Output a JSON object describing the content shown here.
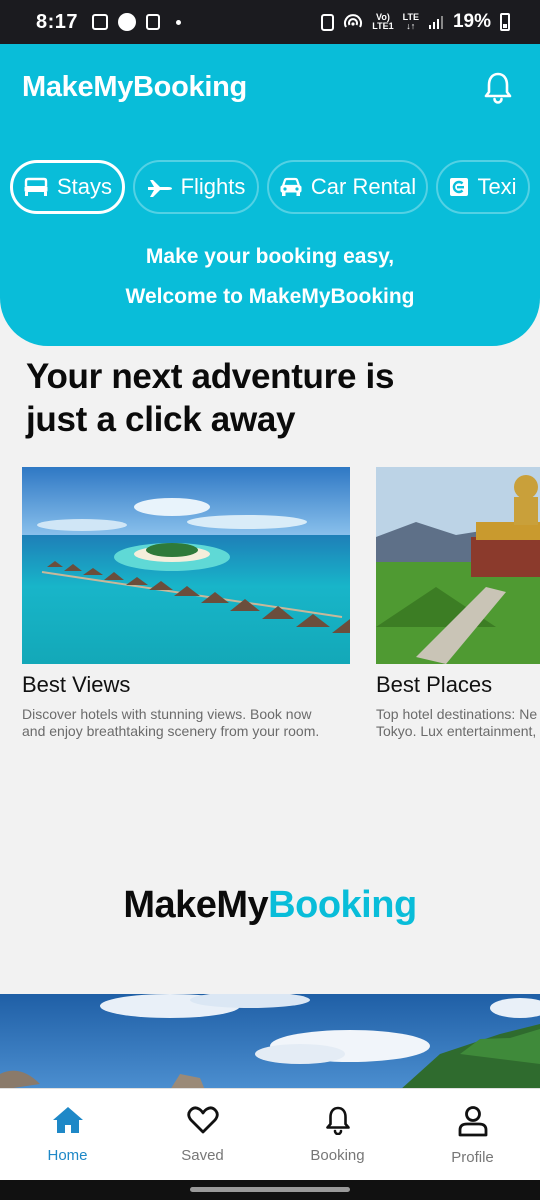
{
  "status_bar": {
    "time": "8:17",
    "network_line1": "Vo)",
    "network_line2": "LTE1",
    "lte_line1": "LTE",
    "lte_line2": "↓↑",
    "battery": "19%"
  },
  "header": {
    "title": "MakeMyBooking",
    "tabs": [
      {
        "label": "Stays",
        "icon": "bed-icon"
      },
      {
        "label": "Flights",
        "icon": "airplane-icon"
      },
      {
        "label": "Car Rental",
        "icon": "car-icon"
      },
      {
        "label": "Texi",
        "icon": "taxi-icon"
      }
    ],
    "welcome_line1": "Make your booking easy,",
    "welcome_line2": "Welcome to MakeMyBooking"
  },
  "main": {
    "headline": "Your next adventure is just a click away",
    "cards": [
      {
        "title": "Best Views",
        "description": "Discover hotels with stunning views. Book now and enjoy breathtaking scenery from your room."
      },
      {
        "title": "Best Places",
        "description": "Top hotel destinations: Ne Dubai, London, Tokyo. Lux entertainment, and unforg await"
      }
    ],
    "brand_part1": "MakeMy",
    "brand_part2": "Booking"
  },
  "bottom_nav": {
    "items": [
      {
        "label": "Home",
        "icon": "home-icon",
        "active": true
      },
      {
        "label": "Saved",
        "icon": "heart-icon"
      },
      {
        "label": "Booking",
        "icon": "bell-icon"
      },
      {
        "label": "Profile",
        "icon": "person-icon"
      }
    ]
  },
  "colors": {
    "accent": "#09bdd9",
    "nav_active": "#1e88c7",
    "background": "#f2f2f2"
  }
}
